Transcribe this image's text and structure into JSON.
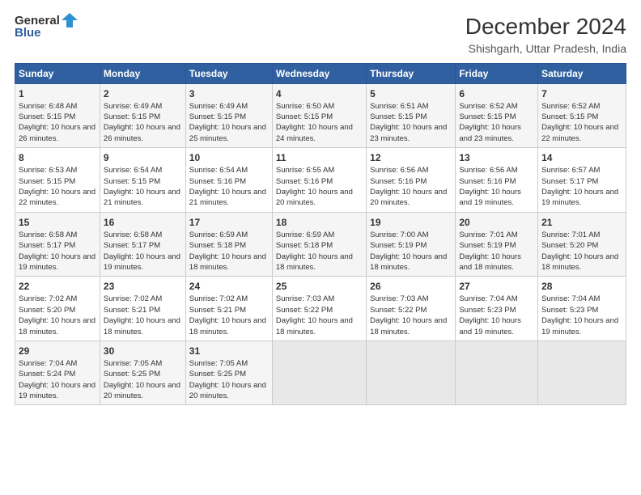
{
  "logo": {
    "line1": "General",
    "line2": "Blue"
  },
  "title": "December 2024",
  "subtitle": "Shishgarh, Uttar Pradesh, India",
  "days_of_week": [
    "Sunday",
    "Monday",
    "Tuesday",
    "Wednesday",
    "Thursday",
    "Friday",
    "Saturday"
  ],
  "weeks": [
    [
      {
        "day": "1",
        "sunrise": "Sunrise: 6:48 AM",
        "sunset": "Sunset: 5:15 PM",
        "daylight": "Daylight: 10 hours and 26 minutes."
      },
      {
        "day": "2",
        "sunrise": "Sunrise: 6:49 AM",
        "sunset": "Sunset: 5:15 PM",
        "daylight": "Daylight: 10 hours and 26 minutes."
      },
      {
        "day": "3",
        "sunrise": "Sunrise: 6:49 AM",
        "sunset": "Sunset: 5:15 PM",
        "daylight": "Daylight: 10 hours and 25 minutes."
      },
      {
        "day": "4",
        "sunrise": "Sunrise: 6:50 AM",
        "sunset": "Sunset: 5:15 PM",
        "daylight": "Daylight: 10 hours and 24 minutes."
      },
      {
        "day": "5",
        "sunrise": "Sunrise: 6:51 AM",
        "sunset": "Sunset: 5:15 PM",
        "daylight": "Daylight: 10 hours and 23 minutes."
      },
      {
        "day": "6",
        "sunrise": "Sunrise: 6:52 AM",
        "sunset": "Sunset: 5:15 PM",
        "daylight": "Daylight: 10 hours and 23 minutes."
      },
      {
        "day": "7",
        "sunrise": "Sunrise: 6:52 AM",
        "sunset": "Sunset: 5:15 PM",
        "daylight": "Daylight: 10 hours and 22 minutes."
      }
    ],
    [
      {
        "day": "8",
        "sunrise": "Sunrise: 6:53 AM",
        "sunset": "Sunset: 5:15 PM",
        "daylight": "Daylight: 10 hours and 22 minutes."
      },
      {
        "day": "9",
        "sunrise": "Sunrise: 6:54 AM",
        "sunset": "Sunset: 5:15 PM",
        "daylight": "Daylight: 10 hours and 21 minutes."
      },
      {
        "day": "10",
        "sunrise": "Sunrise: 6:54 AM",
        "sunset": "Sunset: 5:16 PM",
        "daylight": "Daylight: 10 hours and 21 minutes."
      },
      {
        "day": "11",
        "sunrise": "Sunrise: 6:55 AM",
        "sunset": "Sunset: 5:16 PM",
        "daylight": "Daylight: 10 hours and 20 minutes."
      },
      {
        "day": "12",
        "sunrise": "Sunrise: 6:56 AM",
        "sunset": "Sunset: 5:16 PM",
        "daylight": "Daylight: 10 hours and 20 minutes."
      },
      {
        "day": "13",
        "sunrise": "Sunrise: 6:56 AM",
        "sunset": "Sunset: 5:16 PM",
        "daylight": "Daylight: 10 hours and 19 minutes."
      },
      {
        "day": "14",
        "sunrise": "Sunrise: 6:57 AM",
        "sunset": "Sunset: 5:17 PM",
        "daylight": "Daylight: 10 hours and 19 minutes."
      }
    ],
    [
      {
        "day": "15",
        "sunrise": "Sunrise: 6:58 AM",
        "sunset": "Sunset: 5:17 PM",
        "daylight": "Daylight: 10 hours and 19 minutes."
      },
      {
        "day": "16",
        "sunrise": "Sunrise: 6:58 AM",
        "sunset": "Sunset: 5:17 PM",
        "daylight": "Daylight: 10 hours and 19 minutes."
      },
      {
        "day": "17",
        "sunrise": "Sunrise: 6:59 AM",
        "sunset": "Sunset: 5:18 PM",
        "daylight": "Daylight: 10 hours and 18 minutes."
      },
      {
        "day": "18",
        "sunrise": "Sunrise: 6:59 AM",
        "sunset": "Sunset: 5:18 PM",
        "daylight": "Daylight: 10 hours and 18 minutes."
      },
      {
        "day": "19",
        "sunrise": "Sunrise: 7:00 AM",
        "sunset": "Sunset: 5:19 PM",
        "daylight": "Daylight: 10 hours and 18 minutes."
      },
      {
        "day": "20",
        "sunrise": "Sunrise: 7:01 AM",
        "sunset": "Sunset: 5:19 PM",
        "daylight": "Daylight: 10 hours and 18 minutes."
      },
      {
        "day": "21",
        "sunrise": "Sunrise: 7:01 AM",
        "sunset": "Sunset: 5:20 PM",
        "daylight": "Daylight: 10 hours and 18 minutes."
      }
    ],
    [
      {
        "day": "22",
        "sunrise": "Sunrise: 7:02 AM",
        "sunset": "Sunset: 5:20 PM",
        "daylight": "Daylight: 10 hours and 18 minutes."
      },
      {
        "day": "23",
        "sunrise": "Sunrise: 7:02 AM",
        "sunset": "Sunset: 5:21 PM",
        "daylight": "Daylight: 10 hours and 18 minutes."
      },
      {
        "day": "24",
        "sunrise": "Sunrise: 7:02 AM",
        "sunset": "Sunset: 5:21 PM",
        "daylight": "Daylight: 10 hours and 18 minutes."
      },
      {
        "day": "25",
        "sunrise": "Sunrise: 7:03 AM",
        "sunset": "Sunset: 5:22 PM",
        "daylight": "Daylight: 10 hours and 18 minutes."
      },
      {
        "day": "26",
        "sunrise": "Sunrise: 7:03 AM",
        "sunset": "Sunset: 5:22 PM",
        "daylight": "Daylight: 10 hours and 18 minutes."
      },
      {
        "day": "27",
        "sunrise": "Sunrise: 7:04 AM",
        "sunset": "Sunset: 5:23 PM",
        "daylight": "Daylight: 10 hours and 19 minutes."
      },
      {
        "day": "28",
        "sunrise": "Sunrise: 7:04 AM",
        "sunset": "Sunset: 5:23 PM",
        "daylight": "Daylight: 10 hours and 19 minutes."
      }
    ],
    [
      {
        "day": "29",
        "sunrise": "Sunrise: 7:04 AM",
        "sunset": "Sunset: 5:24 PM",
        "daylight": "Daylight: 10 hours and 19 minutes."
      },
      {
        "day": "30",
        "sunrise": "Sunrise: 7:05 AM",
        "sunset": "Sunset: 5:25 PM",
        "daylight": "Daylight: 10 hours and 20 minutes."
      },
      {
        "day": "31",
        "sunrise": "Sunrise: 7:05 AM",
        "sunset": "Sunset: 5:25 PM",
        "daylight": "Daylight: 10 hours and 20 minutes."
      },
      null,
      null,
      null,
      null
    ]
  ]
}
